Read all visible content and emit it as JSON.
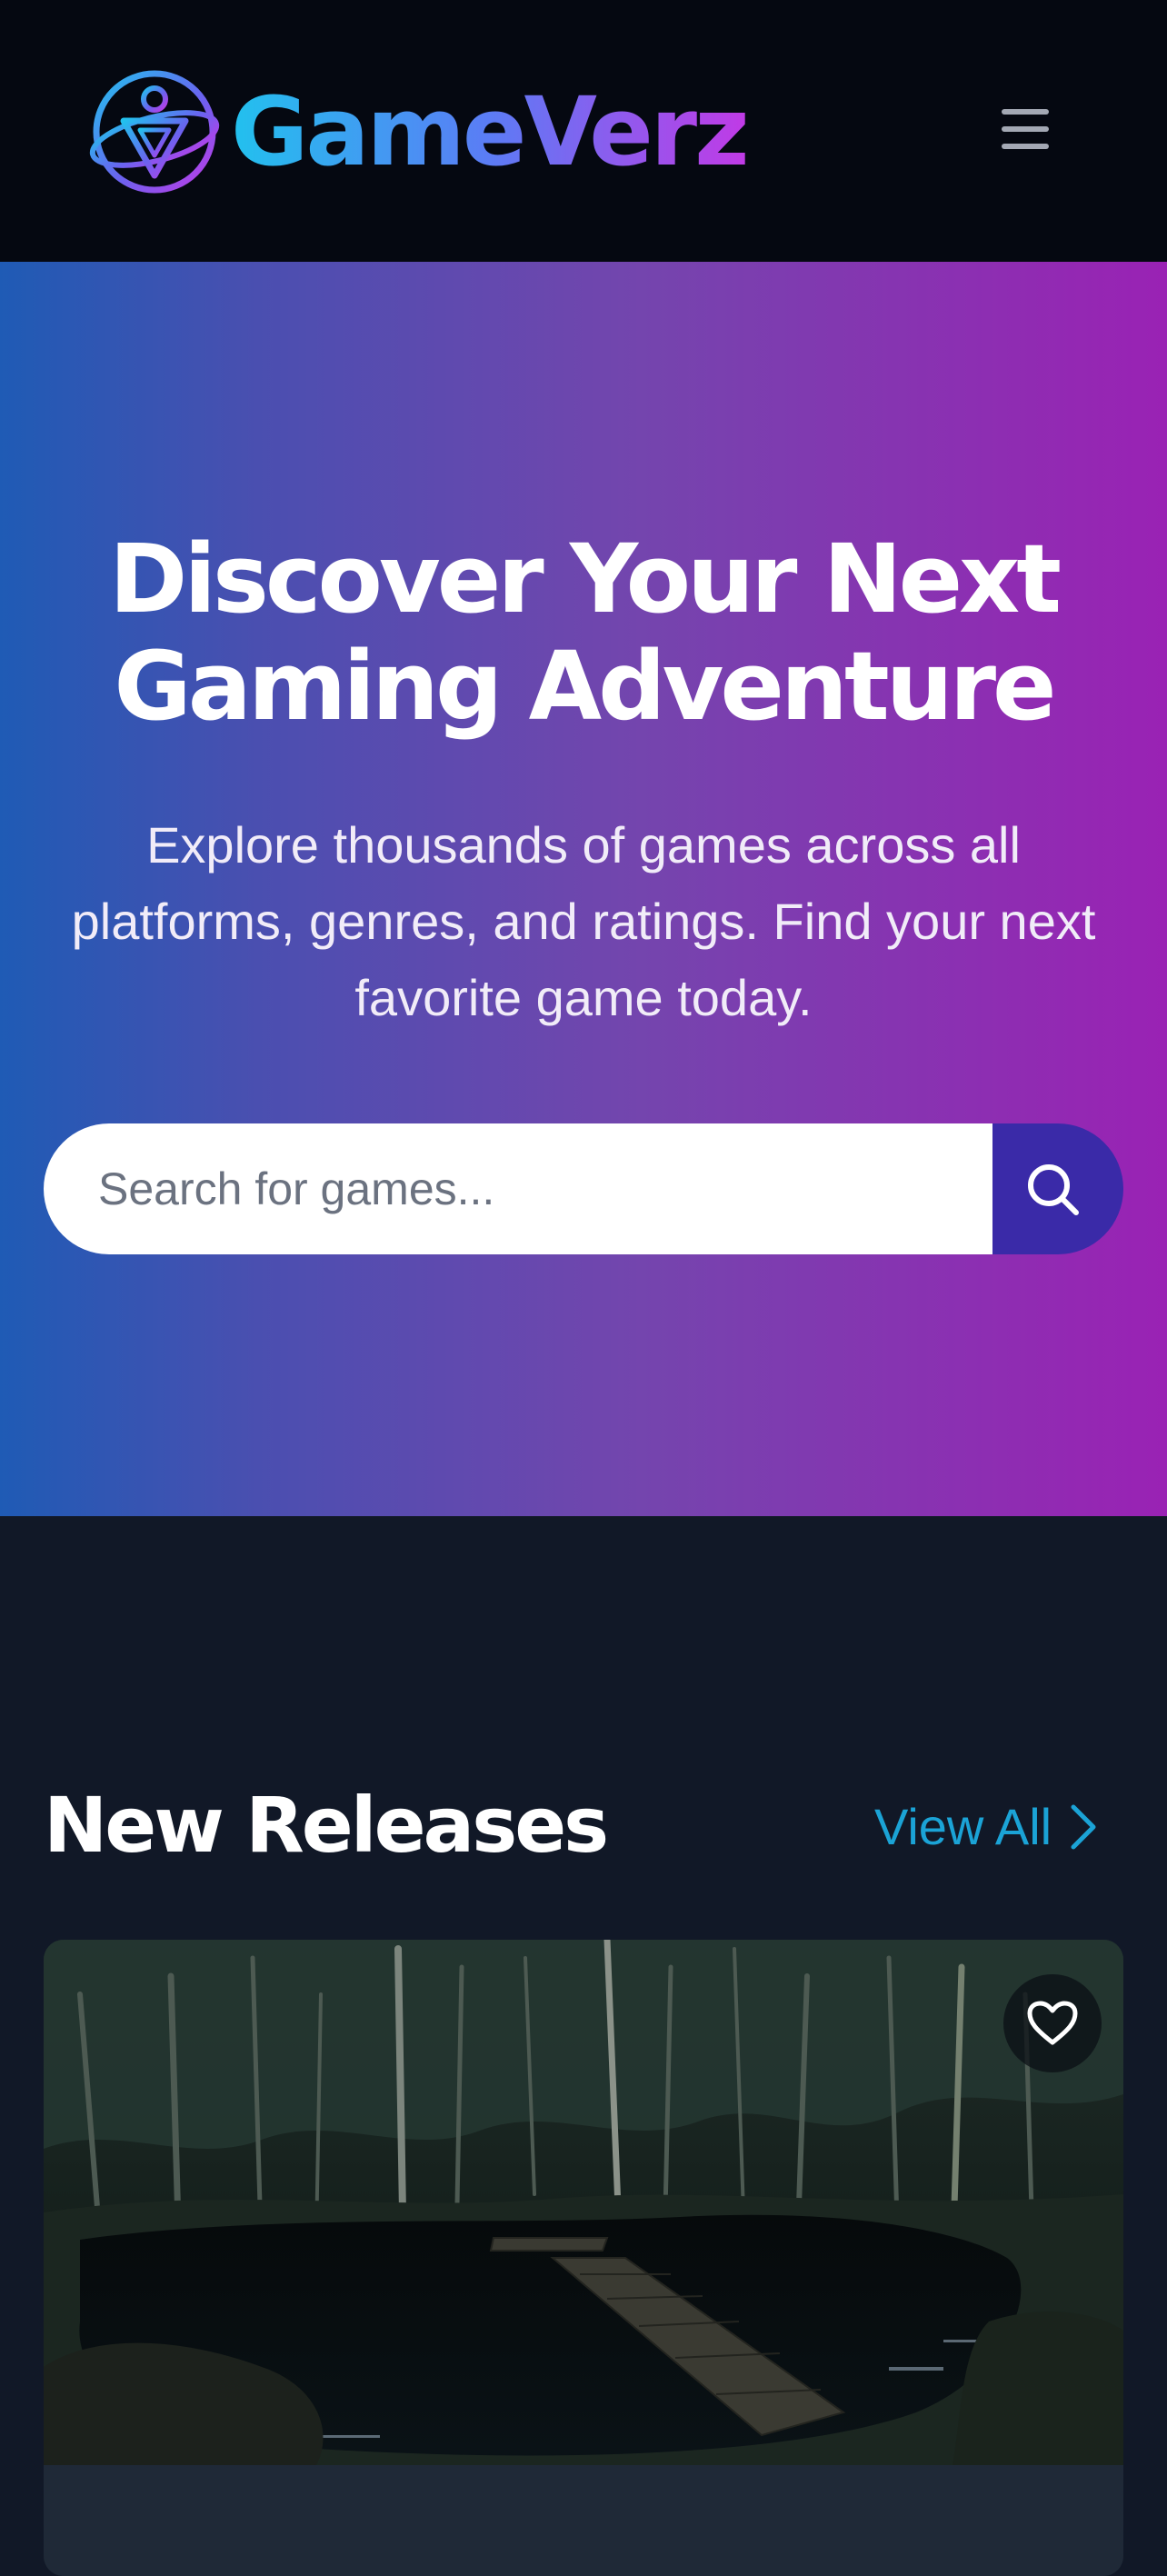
{
  "header": {
    "brand": "GameVerz",
    "menu_icon": "hamburger-menu-icon"
  },
  "hero": {
    "title": "Discover Your Next Gaming Adventure",
    "subtitle": "Explore thousands of games across all platforms, genres, and ratings. Find your next favorite game today.",
    "search_placeholder": "Search for games...",
    "search_icon": "search-icon"
  },
  "new_releases": {
    "title": "New Releases",
    "view_all_label": "View All",
    "view_all_icon": "chevron-right-icon",
    "cards": [
      {
        "image": "forest-lake-dock-scene",
        "favorite_icon": "heart-icon"
      }
    ]
  },
  "colors": {
    "header_bg": "#050811",
    "page_bg": "#111827",
    "hero_gradient_start": "#1f5bb5",
    "hero_gradient_end": "#9a22b4",
    "search_button": "#3a2aa8",
    "link": "#1ba3d6",
    "logo_gradient": [
      "#22c1ee",
      "#5b7cf5",
      "#c13ae6"
    ]
  }
}
